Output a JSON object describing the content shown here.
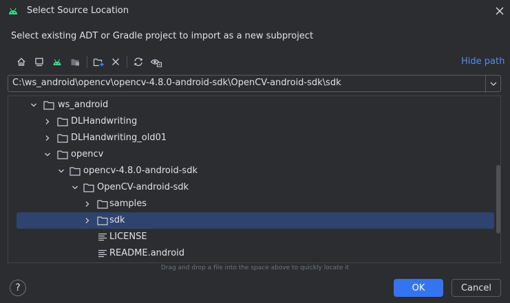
{
  "window": {
    "title": "Select Source Location",
    "icon": "android-icon"
  },
  "subtitle": "Select existing ADT or Gradle project to import as a new subproject",
  "toolbar": {
    "buttons": [
      "home-icon",
      "desktop-icon",
      "android-project-icon",
      "module-folder-icon",
      "new-folder-icon",
      "delete-icon",
      "refresh-icon",
      "show-hidden-icon"
    ],
    "hide_path": "Hide path"
  },
  "path": {
    "value": "C:\\ws_android\\opencv\\opencv-4.8.0-android-sdk\\OpenCV-android-sdk\\sdk"
  },
  "tree": {
    "rows": [
      {
        "label": "ws_android",
        "expanded": true,
        "kind": "folder"
      },
      {
        "label": "DLHandwriting",
        "expanded": false,
        "kind": "folder"
      },
      {
        "label": "DLHandwriting_old01",
        "expanded": false,
        "kind": "folder"
      },
      {
        "label": "opencv",
        "expanded": true,
        "kind": "folder"
      },
      {
        "label": "opencv-4.8.0-android-sdk",
        "expanded": true,
        "kind": "folder"
      },
      {
        "label": "OpenCV-android-sdk",
        "expanded": true,
        "kind": "folder"
      },
      {
        "label": "samples",
        "expanded": false,
        "kind": "folder"
      },
      {
        "label": "sdk",
        "expanded": false,
        "kind": "folder",
        "selected": true
      },
      {
        "label": "LICENSE",
        "kind": "file"
      },
      {
        "label": "README.android",
        "kind": "file"
      }
    ]
  },
  "hint": "Drag and drop a file into the space above to quickly locate it",
  "footer": {
    "help": "?",
    "ok": "OK",
    "cancel": "Cancel"
  },
  "colors": {
    "background": "#2b2d30",
    "accent": "#3574f0",
    "selection": "#2e436e",
    "link": "#548af7",
    "android": "#3ddc84"
  }
}
